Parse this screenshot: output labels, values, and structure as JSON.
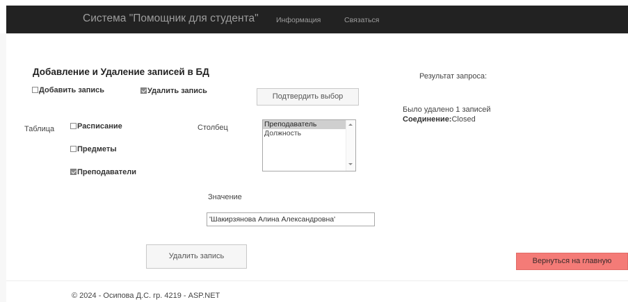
{
  "navbar": {
    "brand": "Система \"Помощник для студента\"",
    "links": [
      "Информация",
      "Связаться"
    ]
  },
  "form": {
    "heading": "Добавление и Удаление записей в БД",
    "actions": [
      {
        "label": "Добавить запись",
        "checked": false
      },
      {
        "label": "Удалить запись",
        "checked": true
      }
    ],
    "confirm_button": "Подтвердить выбор",
    "table_label": "Таблица",
    "tables": [
      {
        "label": "Расписание",
        "checked": false
      },
      {
        "label": "Предметы",
        "checked": false
      },
      {
        "label": "Преподаватели",
        "checked": true
      }
    ],
    "column_label": "Столбец",
    "column_options": [
      "Преподаватель",
      "Должность"
    ],
    "column_selected": "Преподаватель",
    "value_label": "Значение",
    "value_input": "'Шакирзянова Алина Александровна'",
    "submit_button": "Удалить запись"
  },
  "result": {
    "title": "Результат запроса:",
    "message": "Было удалено 1 записей",
    "connection_label": "Соединение:",
    "connection_value": "Closed"
  },
  "back_button": "Вернуться на главную",
  "footer": "© 2024 - Осипова Д.С. гр. 4219 - ASP.NET",
  "colors": {
    "navbar_bg": "#222222",
    "navbar_text": "#9d9d9d",
    "back_button_bg": "#f47b77"
  }
}
